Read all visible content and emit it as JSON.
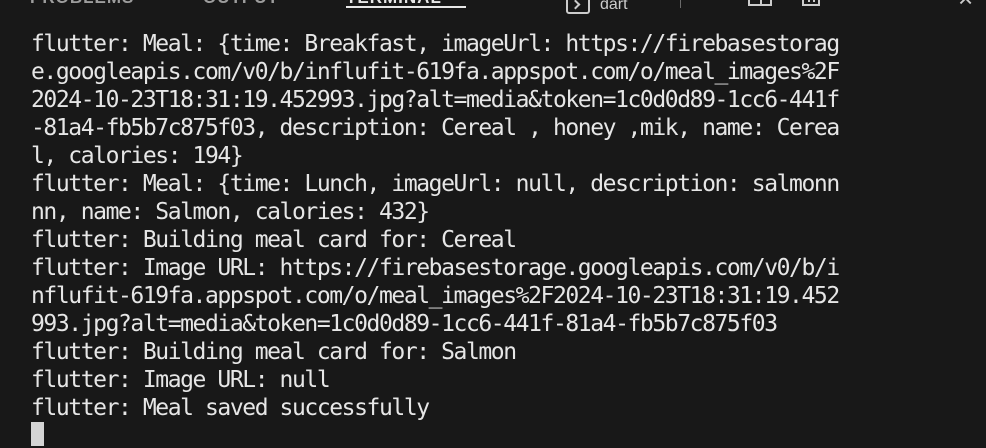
{
  "tabs": [
    {
      "label": "PROBLEMS",
      "active": false
    },
    {
      "label": "OUTPUT",
      "active": false
    },
    {
      "label": "TERMINAL",
      "active": true
    }
  ],
  "terminal_profile": {
    "icon": "terminal-icon",
    "label": "dart"
  },
  "toolbar_icons": [
    "add-icon",
    "chevron-down-icon",
    "split-icon",
    "trash-icon",
    "close-icon"
  ],
  "colors": {
    "background": "#181818",
    "text": "#e6e6e6",
    "active_tab": "#e7e7e7",
    "inactive_tab": "#9d9d9d"
  },
  "terminal": {
    "lines": [
      "flutter: Meal: {time: Breakfast, imageUrl: https://firebasestorag",
      "e.googleapis.com/v0/b/influfit-619fa.appspot.com/o/meal_images%2F",
      "2024-10-23T18:31:19.452993.jpg?alt=media&token=1c0d0d89-1cc6-441f",
      "-81a4-fb5b7c875f03, description: Cereal , honey ,mik, name: Cerea",
      "l, calories: 194}",
      "flutter: Meal: {time: Lunch, imageUrl: null, description: salmonn",
      "nn, name: Salmon, calories: 432}",
      "flutter: Building meal card for: Cereal",
      "flutter: Image URL: https://firebasestorage.googleapis.com/v0/b/i",
      "nflufit-619fa.appspot.com/o/meal_images%2F2024-10-23T18:31:19.452",
      "993.jpg?alt=media&token=1c0d0d89-1cc6-441f-81a4-fb5b7c875f03",
      "flutter: Building meal card for: Salmon",
      "flutter: Image URL: null",
      "flutter: Meal saved successfully"
    ]
  }
}
